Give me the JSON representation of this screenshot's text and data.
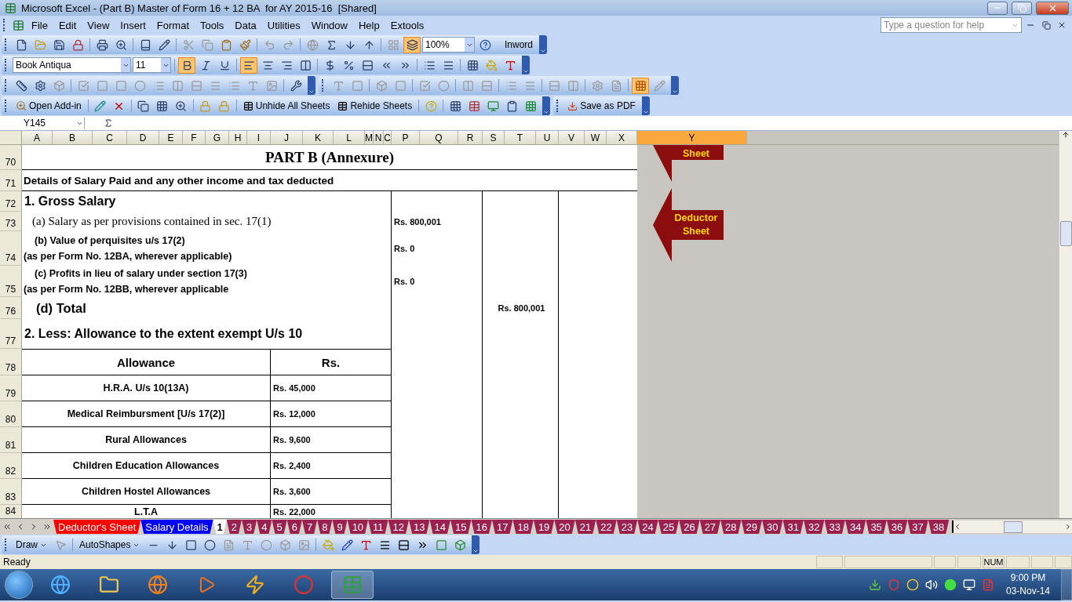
{
  "window": {
    "title": "Microsoft Excel - (Part B) Master of Form 16 + 12 BA  for AY 2015-16  [Shared]"
  },
  "menu": [
    "File",
    "Edit",
    "View",
    "Insert",
    "Format",
    "Tools",
    "Data",
    "Utilities",
    "Window",
    "Help",
    "Extools"
  ],
  "help_search": {
    "placeholder": "Type a question for help"
  },
  "standard_toolbar": {
    "zoom": "100%",
    "inword_button": "Inword"
  },
  "formatting_toolbar": {
    "font": "Book Antiqua",
    "size": "11",
    "bold": true,
    "align_left": true
  },
  "addin_toolbar": {
    "buttons": [
      "Open Add-in",
      "Unhide All Sheets",
      "Rehide Sheets"
    ],
    "save_pdf": "Save as PDF"
  },
  "formula_bar": {
    "name_box": "Y145"
  },
  "columns": [
    {
      "label": "A",
      "selected": false
    },
    {
      "label": "B",
      "selected": false
    },
    {
      "label": "C",
      "selected": false
    },
    {
      "label": "D",
      "selected": false
    },
    {
      "label": "E",
      "selected": false
    },
    {
      "label": "F",
      "selected": false
    },
    {
      "label": "G",
      "selected": false
    },
    {
      "label": "H",
      "selected": false
    },
    {
      "label": "I",
      "selected": false
    },
    {
      "label": "J",
      "selected": false
    },
    {
      "label": "K",
      "selected": false
    },
    {
      "label": "L",
      "selected": false
    },
    {
      "label": "M",
      "selected": false
    },
    {
      "label": "N",
      "selected": false
    },
    {
      "label": "C",
      "selected": false
    },
    {
      "label": "P",
      "selected": false
    },
    {
      "label": "Q",
      "selected": false
    },
    {
      "label": "R",
      "selected": false
    },
    {
      "label": "S",
      "selected": false
    },
    {
      "label": "T",
      "selected": false
    },
    {
      "label": "U",
      "selected": false
    },
    {
      "label": "V",
      "selected": false
    },
    {
      "label": "W",
      "selected": false
    },
    {
      "label": "X",
      "selected": false
    },
    {
      "label": "Y",
      "selected": true
    }
  ],
  "rows": [
    {
      "number": "70",
      "kind": "title",
      "text": "PART B (Annexure)"
    },
    {
      "number": "71",
      "kind": "heading",
      "text": "Details of Salary Paid and any other income and tax deducted"
    },
    {
      "number": "72",
      "kind": "section",
      "text": "1.  Gross Salary"
    },
    {
      "number": "73",
      "kind": "subitem",
      "text": "(a) Salary as per provisions contained in sec. 17(1)",
      "amount": "Rs. 800,001"
    },
    {
      "number": "74",
      "kind": "note",
      "text": "(b) Value of perquisites u/s 17(2)",
      "note": "(as per Form No. 12BA, wherever applicable)",
      "amount": "Rs. 0"
    },
    {
      "number": "75",
      "kind": "note",
      "text": "(c) Profits in lieu of salary under section 17(3)",
      "note": "(as per Form No. 12BB, wherever applicable",
      "amount": "Rs. 0"
    },
    {
      "number": "76",
      "kind": "total",
      "text": "(d) Total",
      "total": "Rs. 800,001"
    },
    {
      "number": "77",
      "kind": "section",
      "text": "2. Less: Allowance to the extent exempt U/s 10"
    },
    {
      "number": "78",
      "kind": "table-head",
      "text": "Allowance",
      "amount_heading": "Rs."
    },
    {
      "number": "79",
      "kind": "allowance",
      "text": "H.R.A. U/s 10(13A)",
      "value": "Rs. 45,000"
    },
    {
      "number": "80",
      "kind": "allowance",
      "text": "Medical Reimbursment [U/s 17(2)]",
      "value": "Rs. 12,000"
    },
    {
      "number": "81",
      "kind": "allowance",
      "text": "Rural Allowances",
      "value": "Rs. 9,600"
    },
    {
      "number": "82",
      "kind": "allowance",
      "text": "Children Education Allowances",
      "value": "Rs. 2,400"
    },
    {
      "number": "83",
      "kind": "allowance",
      "text": "Children Hostel Allowances",
      "value": "Rs. 3,600"
    },
    {
      "number": "84",
      "kind": "allowance",
      "text": "L.T.A",
      "value": "Rs. 22,000"
    }
  ],
  "shapes": [
    {
      "text": "Sheet"
    },
    {
      "text": "Deductor Sheet"
    }
  ],
  "sheet_tabs": [
    {
      "label": "Deductor's Sheet",
      "selected": false,
      "color": "#ff0000"
    },
    {
      "label": "Salary Details",
      "selected": false,
      "color": "#0000ff"
    },
    {
      "label": "1",
      "selected": true
    },
    {
      "label": "2",
      "selected": false,
      "color": "#99204f"
    },
    {
      "label": "3",
      "selected": false,
      "color": "#99204f"
    },
    {
      "label": "4",
      "selected": false,
      "color": "#99204f"
    },
    {
      "label": "5",
      "selected": false,
      "color": "#99204f"
    },
    {
      "label": "6",
      "selected": false,
      "color": "#99204f"
    },
    {
      "label": "7",
      "selected": false,
      "color": "#99204f"
    },
    {
      "label": "8",
      "selected": false,
      "color": "#99204f"
    },
    {
      "label": "9",
      "selected": false,
      "color": "#99204f"
    },
    {
      "label": "10",
      "selected": false,
      "color": "#99204f"
    },
    {
      "label": "11",
      "selected": false,
      "color": "#99204f"
    },
    {
      "label": "12",
      "selected": false,
      "color": "#99204f"
    },
    {
      "label": "13",
      "selected": false,
      "color": "#99204f"
    },
    {
      "label": "14",
      "selected": false,
      "color": "#99204f"
    },
    {
      "label": "15",
      "selected": false,
      "color": "#99204f"
    },
    {
      "label": "16",
      "selected": false,
      "color": "#99204f"
    },
    {
      "label": "17",
      "selected": false,
      "color": "#99204f"
    },
    {
      "label": "18",
      "selected": false,
      "color": "#99204f"
    },
    {
      "label": "19",
      "selected": false,
      "color": "#99204f"
    },
    {
      "label": "20",
      "selected": false,
      "color": "#99204f"
    },
    {
      "label": "21",
      "selected": false,
      "color": "#99204f"
    },
    {
      "label": "22",
      "selected": false,
      "color": "#99204f"
    },
    {
      "label": "23",
      "selected": false,
      "color": "#99204f"
    },
    {
      "label": "24",
      "selected": false,
      "color": "#99204f"
    },
    {
      "label": "25",
      "selected": false,
      "color": "#99204f"
    },
    {
      "label": "26",
      "selected": false,
      "color": "#99204f"
    },
    {
      "label": "27",
      "selected": false,
      "color": "#99204f"
    },
    {
      "label": "28",
      "selected": false,
      "color": "#99204f"
    },
    {
      "label": "29",
      "selected": false,
      "color": "#99204f"
    },
    {
      "label": "30",
      "selected": false,
      "color": "#99204f"
    },
    {
      "label": "31",
      "selected": false,
      "color": "#99204f"
    },
    {
      "label": "32",
      "selected": false,
      "color": "#99204f"
    },
    {
      "label": "33",
      "selected": false,
      "color": "#99204f"
    },
    {
      "label": "34",
      "selected": false,
      "color": "#99204f"
    },
    {
      "label": "35",
      "selected": false,
      "color": "#99204f"
    },
    {
      "label": "36",
      "selected": false,
      "color": "#99204f"
    },
    {
      "label": "37",
      "selected": false,
      "color": "#99204f"
    },
    {
      "label": "38",
      "selected": false,
      "color": "#99204f"
    }
  ],
  "drawing_toolbar": {
    "draw": "Draw",
    "autoshapes": "AutoShapes"
  },
  "status_bar": {
    "status": "Ready",
    "indicator": "NUM"
  },
  "taskbar": {
    "time": "9:00 PM",
    "date": "03-Nov-14"
  }
}
